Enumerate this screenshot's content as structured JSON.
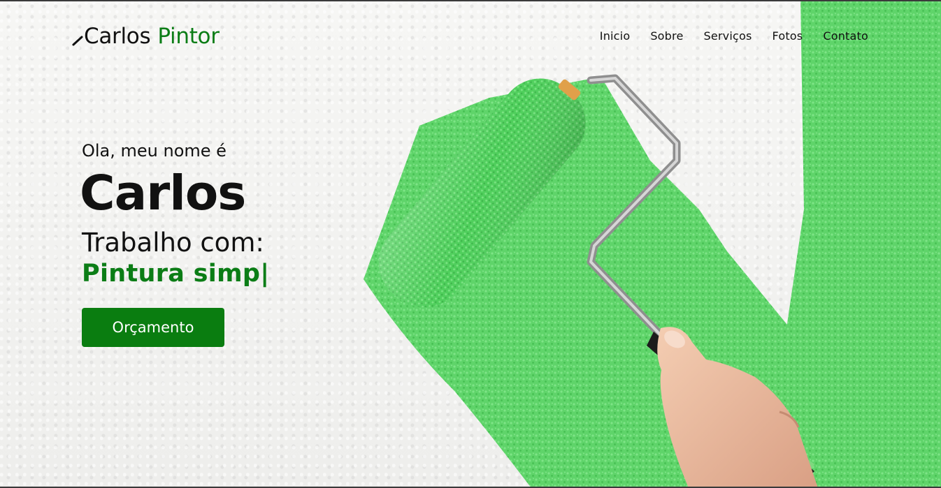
{
  "header": {
    "logo_first": "Carlos",
    "logo_second": "Pintor",
    "nav": [
      {
        "label": "Inicio"
      },
      {
        "label": "Sobre"
      },
      {
        "label": "Serviços"
      },
      {
        "label": "Fotos"
      },
      {
        "label": "Contato"
      }
    ]
  },
  "hero": {
    "intro": "Ola, meu nome é",
    "name": "Carlos",
    "works_label": "Trabalho com:",
    "typed_text": "Pintura simp|",
    "cta_label": "Orçamento"
  },
  "icons": {
    "logo_icon": "paint-brush-icon"
  },
  "colors": {
    "accent": "#0b7d16",
    "button": "#0a7d10",
    "paint": "#5fd46a"
  }
}
